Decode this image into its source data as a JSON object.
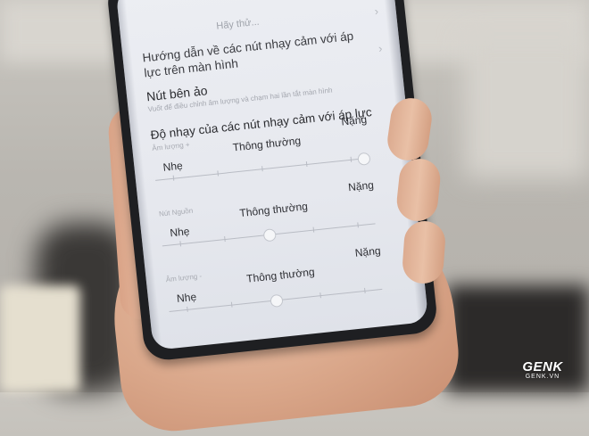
{
  "screen": {
    "partial_title": "Hãy thử...",
    "guide_text": "Hướng dẫn về các nút nhạy cảm với áp lực trên màn hình",
    "virtual_button": {
      "title": "Nút bên ảo",
      "subtitle": "Vuốt để điều chỉnh âm lượng và chạm hai lần tắt màn hình"
    },
    "sensitivity_title": "Độ nhạy của các nút nhạy cảm với áp lực",
    "sliders": [
      {
        "caption": "Âm lượng +",
        "min_label": "Nhẹ",
        "mid_label": "Thông thường",
        "max_label": "Nặng",
        "level": 1.0
      },
      {
        "caption": "Nút Nguồn",
        "min_label": "Nhẹ",
        "mid_label": "Thông thường",
        "max_label": "Nặng",
        "level": 0.5
      },
      {
        "caption": "Âm lượng -",
        "min_label": "Nhẹ",
        "mid_label": "Thông thường",
        "max_label": "Nặng",
        "level": 0.5
      }
    ]
  },
  "watermark": {
    "logo": "GENK",
    "domain": "GENK.VN"
  },
  "icons": {
    "chevron": "chevron-right-icon"
  }
}
